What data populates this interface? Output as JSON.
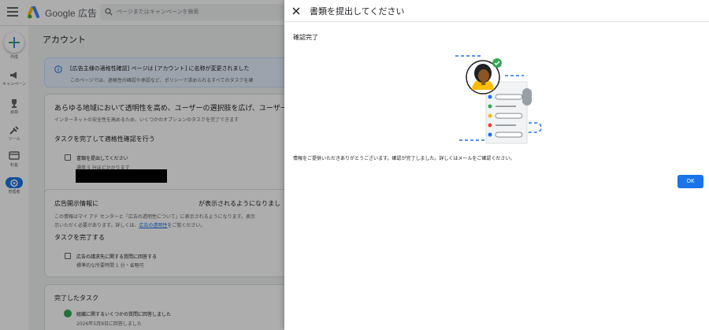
{
  "app": {
    "brand": "Google 広告"
  },
  "search": {
    "placeholder": "ページまたはキャンペーンを検索"
  },
  "rail": {
    "items": [
      {
        "label": "作成",
        "icon": "plus-icon"
      },
      {
        "label": "キャンペーン",
        "icon": "megaphone-icon"
      },
      {
        "label": "目標",
        "icon": "trophy-icon"
      },
      {
        "label": "ツール",
        "icon": "tools-icon"
      },
      {
        "label": "料金",
        "icon": "credit-card-icon"
      },
      {
        "label": "管理者",
        "icon": "gear-icon"
      }
    ]
  },
  "main": {
    "title": "アカウント",
    "notice": {
      "line1": "[広告主様の適格性確認] ページは [アカウント] に名称が変更されました",
      "line2": "このページでは、適格性の確認や承認など、ポリシーで求められるすべてのタスクを確"
    },
    "transparency": {
      "heading": "あらゆる地域において透明性を高め、ユーザーの選択肢を広げ、ユーザー",
      "desc": "インターネットの安全性を高めるため、いくつかのオプションのタスクを完了できます",
      "task_heading": "タスクを完了して適格性確認を行う",
      "task_title": "書類を提出してください",
      "task_time": "通常 5 分ほどかかります"
    },
    "disclosure": {
      "heading_prefix": "広告開示情報に",
      "heading_suffix": "が表示されるようになりまし",
      "desc1": "この情報はマイ アド センターと「広告の透明性について」に表示されるようになります。表示",
      "desc2_prefix": "示いただく必要があります。詳しくは、",
      "desc2_link": "広告の透明性",
      "desc2_suffix": "をご覧ください。",
      "task_heading": "タスクを完了する",
      "task_title": "広告の請求先に関する質問に回答する",
      "task_time": "標準的な所要時間 1 分・省略可"
    },
    "completed": {
      "heading": "完了したタスク",
      "item_title": "組織に関するいくつかの質問に回答しました",
      "item_date": "2026年5月9日に回答しました"
    }
  },
  "dialog": {
    "title": "書類を提出してください",
    "subtitle": "確認完了",
    "message": "情報をご提供いただきありがとうございます。確認が完了しました。詳しくはメールをご確認ください。",
    "ok_label": "OK",
    "illustration": "person-with-checklist-illustration"
  },
  "colors": {
    "accent": "#1a73e8",
    "green": "#34a853",
    "yellow": "#fbbc04",
    "red": "#ea4335"
  }
}
